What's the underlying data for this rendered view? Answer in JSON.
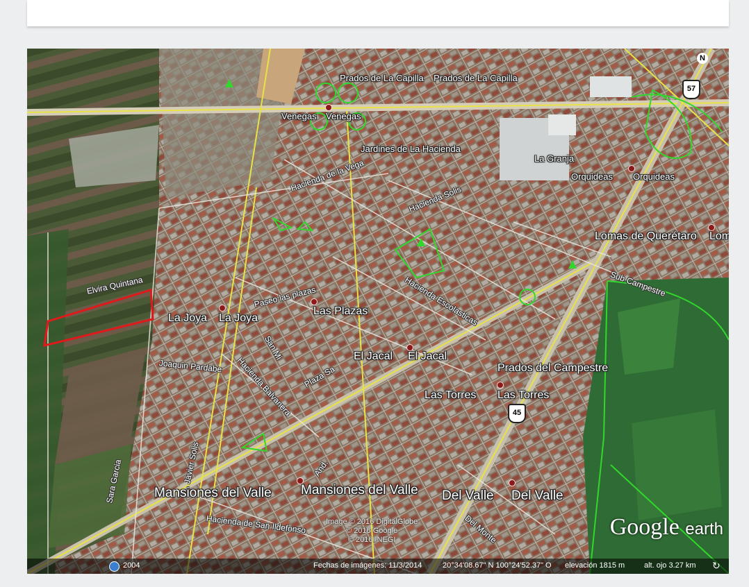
{
  "colors": {
    "page_bg": "#eceef0",
    "card": "#ffffff",
    "parcel_outline": "#e01a1a",
    "boundary": "#31d82b",
    "highway": "#e9e245"
  },
  "icons": [
    "north-icon",
    "globe-icon",
    "refresh-icon",
    "highway-shield-icon",
    "park-icon",
    "place-pin-icon"
  ],
  "neighborhoods": [
    {
      "id": "prados-capilla-1",
      "text": "Prados de La Capilla"
    },
    {
      "id": "prados-capilla-2",
      "text": "Prados de La Capilla"
    },
    {
      "id": "venegas-1",
      "text": "Venegas"
    },
    {
      "id": "venegas-2",
      "text": "Venegas"
    },
    {
      "id": "jardines",
      "text": "Jardines de La Hacienda"
    },
    {
      "id": "la-granja",
      "text": "La Granja"
    },
    {
      "id": "orquideas-1",
      "text": "Orquideas"
    },
    {
      "id": "orquideas-2",
      "text": "Orquideas"
    },
    {
      "id": "lomas-1",
      "text": "Lomas de Querétaro"
    },
    {
      "id": "lomas-2",
      "text": "Lom"
    },
    {
      "id": "la-joya-1",
      "text": "La Joya"
    },
    {
      "id": "la-joya-2",
      "text": "La Joya"
    },
    {
      "id": "las-plazas",
      "text": "Las Plazas"
    },
    {
      "id": "el-jacal-1",
      "text": "El Jacal"
    },
    {
      "id": "el-jacal-2",
      "text": "El Jacal"
    },
    {
      "id": "prados-campestre",
      "text": "Prados del Campestre"
    },
    {
      "id": "las-torres-1",
      "text": "Las Torres"
    },
    {
      "id": "las-torres-2",
      "text": "Las Torres"
    },
    {
      "id": "mansiones-1",
      "text": "Mansiones del Valle"
    },
    {
      "id": "mansiones-2",
      "text": "Mansiones del Valle"
    },
    {
      "id": "del-valle-1",
      "text": "Del Valle"
    },
    {
      "id": "del-valle-2",
      "text": "Del Valle"
    }
  ],
  "streets": [
    {
      "id": "elvira",
      "text": "Elvira Quintana"
    },
    {
      "id": "joaquin",
      "text": "Joaquin Pardabe"
    },
    {
      "id": "sara",
      "text": "Sara Garcia"
    },
    {
      "id": "javier",
      "text": "Javier Solis"
    },
    {
      "id": "san-ildefonso",
      "text": "Hacienda de San Ildefonso"
    },
    {
      "id": "balvanera",
      "text": "Hacienda Balvanera"
    },
    {
      "id": "del-monte",
      "text": "Del Monte"
    },
    {
      "id": "campestre",
      "text": "Sub Campestre"
    },
    {
      "id": "paseo-plazas",
      "text": "Paseo las plazas"
    },
    {
      "id": "plaza-sa",
      "text": "Plaza Sa"
    },
    {
      "id": "escolasticas",
      "text": "Hacienda Escolasticas"
    },
    {
      "id": "and",
      "text": "And."
    },
    {
      "id": "san-m",
      "text": "San Mi"
    },
    {
      "id": "ha-vega",
      "text": "Hacienda de la Vega"
    },
    {
      "id": "ha-solis",
      "text": "Hacienda Solis"
    }
  ],
  "shields": [
    {
      "id": "sh57",
      "text": "57"
    },
    {
      "id": "sh45",
      "text": "45"
    }
  ],
  "north_label": "N",
  "copyright": {
    "line1": "Image © 2016 DigitalGlobe",
    "line2": "© 2016 Google",
    "line3": "© 2016 INEGI"
  },
  "logo": {
    "google": "Google",
    "earth": "earth"
  },
  "status": {
    "year": "2004",
    "dates": "Fechas de imágenes: 11/3/2014",
    "coords": "20°34'08.67\" N  100°24'52.37\" O",
    "elevation": "elevación  1815 m",
    "eye": "alt. ojo   3.27 km"
  }
}
